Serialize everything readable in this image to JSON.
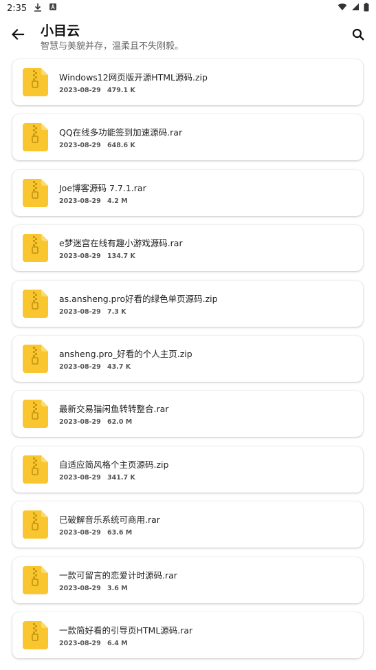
{
  "status": {
    "time": "2:35"
  },
  "appbar": {
    "title": "小目云",
    "subtitle": "智慧与美貌并存，温柔且不失刚毅。"
  },
  "files": [
    {
      "name": "Windows12网页版开源HTML源码.zip",
      "date": "2023-08-29",
      "size": "479.1 K"
    },
    {
      "name": "QQ在线多功能签到加速源码.rar",
      "date": "2023-08-29",
      "size": "648.6 K"
    },
    {
      "name": "Joe博客源码 7.7.1.rar",
      "date": "2023-08-29",
      "size": "4.2 M"
    },
    {
      "name": "e梦迷宫在线有趣小游戏源码.rar",
      "date": "2023-08-29",
      "size": "134.7 K"
    },
    {
      "name": "as.ansheng.pro好看的绿色单页源码.zip",
      "date": "2023-08-29",
      "size": "7.3 K"
    },
    {
      "name": "ansheng.pro_好看的个人主页.zip",
      "date": "2023-08-29",
      "size": "43.7 K"
    },
    {
      "name": "最新交易猫闲鱼转转整合.rar",
      "date": "2023-08-29",
      "size": "62.0 M"
    },
    {
      "name": "自适应简风格个主页源码.zip",
      "date": "2023-08-29",
      "size": "341.7 K"
    },
    {
      "name": "已破解音乐系统可商用.rar",
      "date": "2023-08-29",
      "size": "63.6 M"
    },
    {
      "name": "一款可留言的恋爱计时源码.rar",
      "date": "2023-08-29",
      "size": "3.6 M"
    },
    {
      "name": "一款简好看的引导页HTML源码.rar",
      "date": "2023-08-29",
      "size": "6.4 M"
    }
  ],
  "colors": {
    "zip_icon": "#F9C62F",
    "zip_icon_fold": "#FBDA70",
    "zipper": "#C89A14"
  }
}
